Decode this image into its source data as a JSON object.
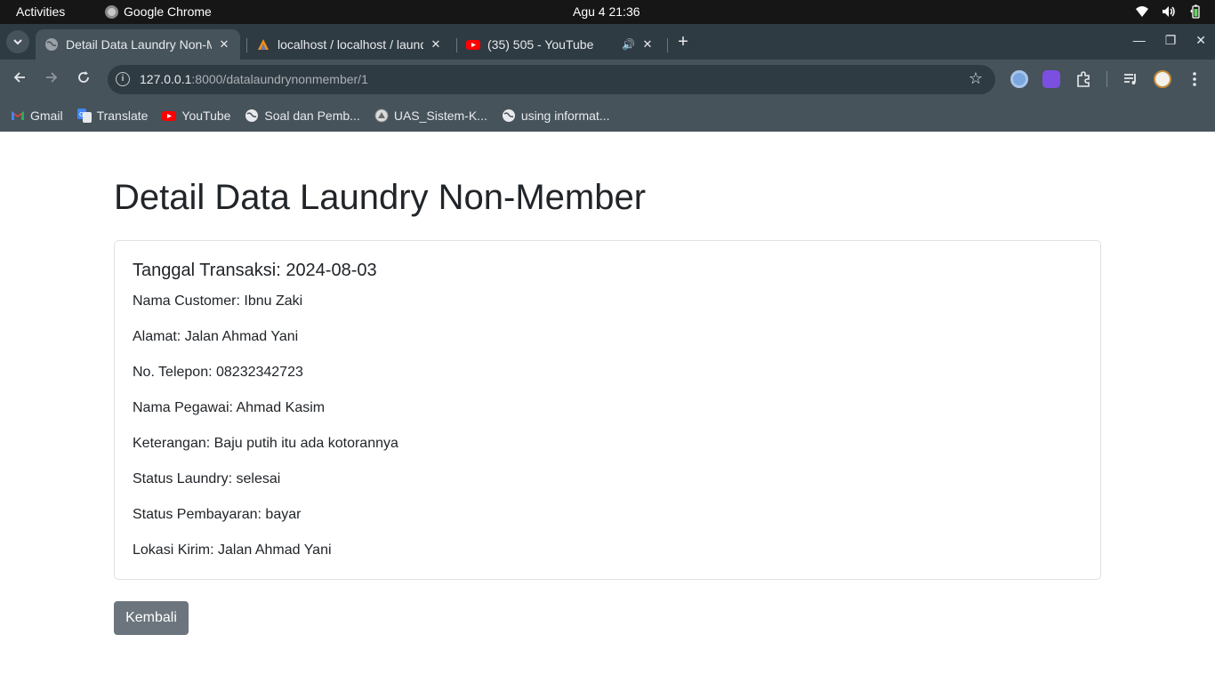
{
  "system_bar": {
    "activities": "Activities",
    "app_name": "Google Chrome",
    "clock": "Agu 4  21:36"
  },
  "tabs": [
    {
      "title": "Detail Data Laundry Non-Member",
      "active": true,
      "icon": "globe-icon"
    },
    {
      "title": "localhost / localhost / laundry",
      "active": false,
      "icon": "phpmyadmin-icon"
    },
    {
      "title": "(35) 505 - YouTube",
      "active": false,
      "icon": "youtube-icon",
      "audio": true
    }
  ],
  "address_bar": {
    "host": "127.0.0.1",
    "path": ":8000/datalaundrynonmember/1"
  },
  "bookmarks": [
    {
      "label": "Gmail",
      "icon": "gmail-icon"
    },
    {
      "label": "Translate",
      "icon": "translate-icon"
    },
    {
      "label": "YouTube",
      "icon": "youtube-icon"
    },
    {
      "label": "Soal dan Pemb...",
      "icon": "globe-icon"
    },
    {
      "label": "UAS_Sistem-K...",
      "icon": "seal-icon"
    },
    {
      "label": "using informat...",
      "icon": "globe-icon"
    }
  ],
  "page": {
    "title": "Detail Data Laundry Non-Member",
    "card_title": "Tanggal Transaksi: 2024-08-03",
    "fields": [
      "Nama Customer: Ibnu Zaki",
      "Alamat: Jalan Ahmad Yani",
      "No. Telepon: 08232342723",
      "Nama Pegawai: Ahmad Kasim",
      "Keterangan: Baju putih itu ada kotorannya",
      "Status Laundry: selesai",
      "Status Pembayaran: bayar",
      "Lokasi Kirim: Jalan Ahmad Yani"
    ],
    "back_button": "Kembali"
  },
  "colors": {
    "button_secondary": "#6c757d",
    "text": "#212529",
    "card_border": "#dfe1e4",
    "chrome_toolbar": "#46535b",
    "chrome_tabstrip": "#2f3b43"
  }
}
